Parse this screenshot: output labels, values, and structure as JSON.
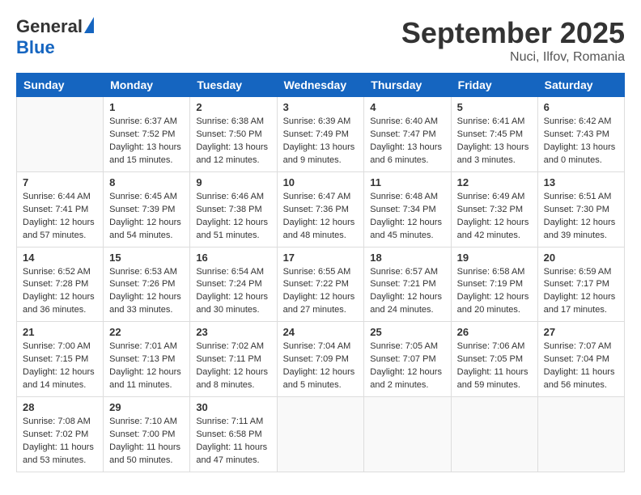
{
  "header": {
    "logo_general": "General",
    "logo_blue": "Blue",
    "month_title": "September 2025",
    "location": "Nuci, Ilfov, Romania"
  },
  "weekdays": [
    "Sunday",
    "Monday",
    "Tuesday",
    "Wednesday",
    "Thursday",
    "Friday",
    "Saturday"
  ],
  "weeks": [
    [
      {
        "day": "",
        "sunrise": "",
        "sunset": "",
        "daylight": ""
      },
      {
        "day": "1",
        "sunrise": "Sunrise: 6:37 AM",
        "sunset": "Sunset: 7:52 PM",
        "daylight": "Daylight: 13 hours and 15 minutes."
      },
      {
        "day": "2",
        "sunrise": "Sunrise: 6:38 AM",
        "sunset": "Sunset: 7:50 PM",
        "daylight": "Daylight: 13 hours and 12 minutes."
      },
      {
        "day": "3",
        "sunrise": "Sunrise: 6:39 AM",
        "sunset": "Sunset: 7:49 PM",
        "daylight": "Daylight: 13 hours and 9 minutes."
      },
      {
        "day": "4",
        "sunrise": "Sunrise: 6:40 AM",
        "sunset": "Sunset: 7:47 PM",
        "daylight": "Daylight: 13 hours and 6 minutes."
      },
      {
        "day": "5",
        "sunrise": "Sunrise: 6:41 AM",
        "sunset": "Sunset: 7:45 PM",
        "daylight": "Daylight: 13 hours and 3 minutes."
      },
      {
        "day": "6",
        "sunrise": "Sunrise: 6:42 AM",
        "sunset": "Sunset: 7:43 PM",
        "daylight": "Daylight: 13 hours and 0 minutes."
      }
    ],
    [
      {
        "day": "7",
        "sunrise": "Sunrise: 6:44 AM",
        "sunset": "Sunset: 7:41 PM",
        "daylight": "Daylight: 12 hours and 57 minutes."
      },
      {
        "day": "8",
        "sunrise": "Sunrise: 6:45 AM",
        "sunset": "Sunset: 7:39 PM",
        "daylight": "Daylight: 12 hours and 54 minutes."
      },
      {
        "day": "9",
        "sunrise": "Sunrise: 6:46 AM",
        "sunset": "Sunset: 7:38 PM",
        "daylight": "Daylight: 12 hours and 51 minutes."
      },
      {
        "day": "10",
        "sunrise": "Sunrise: 6:47 AM",
        "sunset": "Sunset: 7:36 PM",
        "daylight": "Daylight: 12 hours and 48 minutes."
      },
      {
        "day": "11",
        "sunrise": "Sunrise: 6:48 AM",
        "sunset": "Sunset: 7:34 PM",
        "daylight": "Daylight: 12 hours and 45 minutes."
      },
      {
        "day": "12",
        "sunrise": "Sunrise: 6:49 AM",
        "sunset": "Sunset: 7:32 PM",
        "daylight": "Daylight: 12 hours and 42 minutes."
      },
      {
        "day": "13",
        "sunrise": "Sunrise: 6:51 AM",
        "sunset": "Sunset: 7:30 PM",
        "daylight": "Daylight: 12 hours and 39 minutes."
      }
    ],
    [
      {
        "day": "14",
        "sunrise": "Sunrise: 6:52 AM",
        "sunset": "Sunset: 7:28 PM",
        "daylight": "Daylight: 12 hours and 36 minutes."
      },
      {
        "day": "15",
        "sunrise": "Sunrise: 6:53 AM",
        "sunset": "Sunset: 7:26 PM",
        "daylight": "Daylight: 12 hours and 33 minutes."
      },
      {
        "day": "16",
        "sunrise": "Sunrise: 6:54 AM",
        "sunset": "Sunset: 7:24 PM",
        "daylight": "Daylight: 12 hours and 30 minutes."
      },
      {
        "day": "17",
        "sunrise": "Sunrise: 6:55 AM",
        "sunset": "Sunset: 7:22 PM",
        "daylight": "Daylight: 12 hours and 27 minutes."
      },
      {
        "day": "18",
        "sunrise": "Sunrise: 6:57 AM",
        "sunset": "Sunset: 7:21 PM",
        "daylight": "Daylight: 12 hours and 24 minutes."
      },
      {
        "day": "19",
        "sunrise": "Sunrise: 6:58 AM",
        "sunset": "Sunset: 7:19 PM",
        "daylight": "Daylight: 12 hours and 20 minutes."
      },
      {
        "day": "20",
        "sunrise": "Sunrise: 6:59 AM",
        "sunset": "Sunset: 7:17 PM",
        "daylight": "Daylight: 12 hours and 17 minutes."
      }
    ],
    [
      {
        "day": "21",
        "sunrise": "Sunrise: 7:00 AM",
        "sunset": "Sunset: 7:15 PM",
        "daylight": "Daylight: 12 hours and 14 minutes."
      },
      {
        "day": "22",
        "sunrise": "Sunrise: 7:01 AM",
        "sunset": "Sunset: 7:13 PM",
        "daylight": "Daylight: 12 hours and 11 minutes."
      },
      {
        "day": "23",
        "sunrise": "Sunrise: 7:02 AM",
        "sunset": "Sunset: 7:11 PM",
        "daylight": "Daylight: 12 hours and 8 minutes."
      },
      {
        "day": "24",
        "sunrise": "Sunrise: 7:04 AM",
        "sunset": "Sunset: 7:09 PM",
        "daylight": "Daylight: 12 hours and 5 minutes."
      },
      {
        "day": "25",
        "sunrise": "Sunrise: 7:05 AM",
        "sunset": "Sunset: 7:07 PM",
        "daylight": "Daylight: 12 hours and 2 minutes."
      },
      {
        "day": "26",
        "sunrise": "Sunrise: 7:06 AM",
        "sunset": "Sunset: 7:05 PM",
        "daylight": "Daylight: 11 hours and 59 minutes."
      },
      {
        "day": "27",
        "sunrise": "Sunrise: 7:07 AM",
        "sunset": "Sunset: 7:04 PM",
        "daylight": "Daylight: 11 hours and 56 minutes."
      }
    ],
    [
      {
        "day": "28",
        "sunrise": "Sunrise: 7:08 AM",
        "sunset": "Sunset: 7:02 PM",
        "daylight": "Daylight: 11 hours and 53 minutes."
      },
      {
        "day": "29",
        "sunrise": "Sunrise: 7:10 AM",
        "sunset": "Sunset: 7:00 PM",
        "daylight": "Daylight: 11 hours and 50 minutes."
      },
      {
        "day": "30",
        "sunrise": "Sunrise: 7:11 AM",
        "sunset": "Sunset: 6:58 PM",
        "daylight": "Daylight: 11 hours and 47 minutes."
      },
      {
        "day": "",
        "sunrise": "",
        "sunset": "",
        "daylight": ""
      },
      {
        "day": "",
        "sunrise": "",
        "sunset": "",
        "daylight": ""
      },
      {
        "day": "",
        "sunrise": "",
        "sunset": "",
        "daylight": ""
      },
      {
        "day": "",
        "sunrise": "",
        "sunset": "",
        "daylight": ""
      }
    ]
  ]
}
